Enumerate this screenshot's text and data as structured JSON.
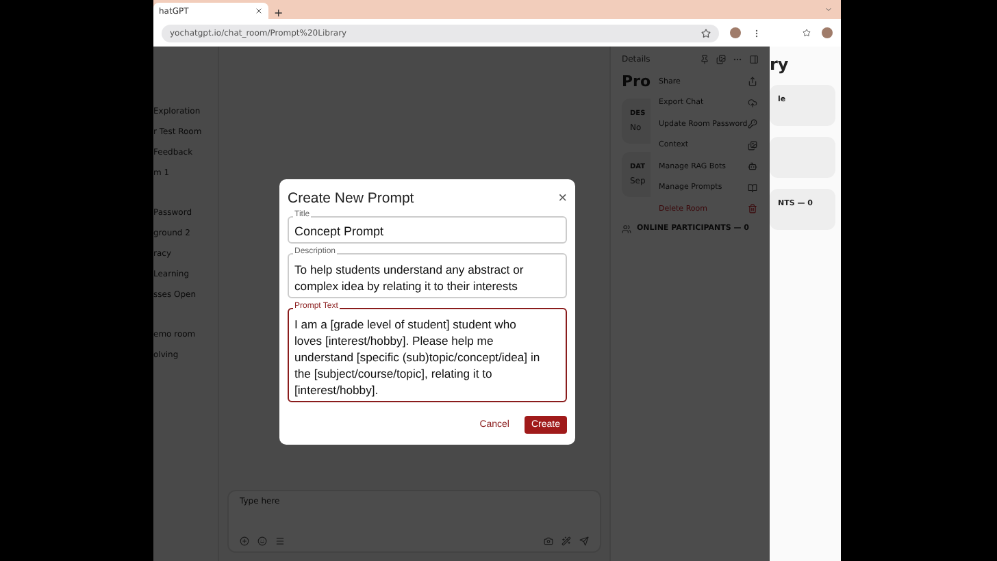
{
  "browser": {
    "tab_title": "hatGPT",
    "new_tab": "+",
    "url": "yochatgpt.io/chat_room/Prompt%20Library"
  },
  "sidebar": {
    "items": [
      "Exploration",
      "r Test Room",
      "Feedback",
      "m 1",
      "Password",
      "ground 2",
      "racy",
      "Learning",
      "sses Open",
      "emo room",
      "olving"
    ]
  },
  "chat": {
    "placeholder": "Type here"
  },
  "details": {
    "header": "Details",
    "title": "Pro",
    "sections": [
      {
        "label": "DES",
        "value": "No"
      },
      {
        "label": "DAT",
        "value": "Sep"
      }
    ],
    "participants": "ONLINE PARTICIPANTS — 0"
  },
  "menu": {
    "items": [
      {
        "label": "Share",
        "kind": "normal"
      },
      {
        "label": "Export Chat",
        "kind": "normal"
      },
      {
        "label": "Update Room Password",
        "kind": "normal"
      },
      {
        "label": "Context",
        "kind": "normal"
      },
      {
        "label": "Manage RAG Bots",
        "kind": "normal"
      },
      {
        "label": "Manage Prompts",
        "kind": "normal"
      },
      {
        "label": "Delete Room",
        "kind": "danger"
      }
    ]
  },
  "side_window": {
    "title": "ry",
    "cards": [
      "le",
      "NTS — 0"
    ]
  },
  "modal": {
    "title": "Create New Prompt",
    "close": "×",
    "fields": [
      {
        "label": "Title",
        "value": "Concept Prompt",
        "multiline": false,
        "focused": false
      },
      {
        "label": "Description",
        "value": "To help students understand any abstract or complex idea by relating it to their interests",
        "multiline": true,
        "focused": false
      },
      {
        "label": "Prompt Text",
        "value": "I am a [grade level of student] student who loves [interest/hobby]. Please help me understand [specific (sub)topic/concept/idea] in the [subject/course/topic], relating it to [interest/hobby].",
        "multiline": true,
        "focused": true
      }
    ],
    "buttons": [
      {
        "label": "Cancel",
        "kind": "text"
      },
      {
        "label": "Create",
        "kind": "primary"
      }
    ]
  }
}
